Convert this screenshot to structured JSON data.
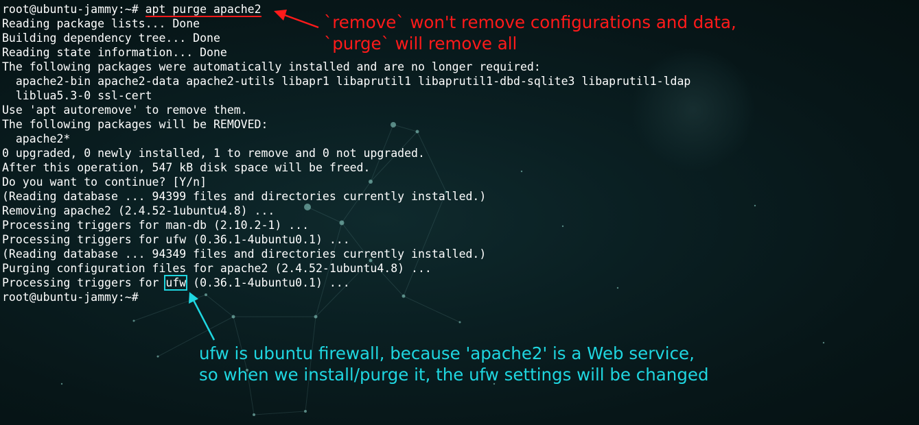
{
  "terminal": {
    "lines": [
      "root@ubuntu-jammy:~# apt purge apache2",
      "Reading package lists... Done",
      "Building dependency tree... Done",
      "Reading state information... Done",
      "The following packages were automatically installed and are no longer required:",
      "  apache2-bin apache2-data apache2-utils libapr1 libaprutil1 libaprutil1-dbd-sqlite3 libaprutil1-ldap",
      "  liblua5.3-0 ssl-cert",
      "Use 'apt autoremove' to remove them.",
      "The following packages will be REMOVED:",
      "  apache2*",
      "0 upgraded, 0 newly installed, 1 to remove and 0 not upgraded.",
      "After this operation, 547 kB disk space will be freed.",
      "Do you want to continue? [Y/n]",
      "(Reading database ... 94399 files and directories currently installed.)",
      "Removing apache2 (2.4.52-1ubuntu4.8) ...",
      "Processing triggers for man-db (2.10.2-1) ...",
      "Processing triggers for ufw (0.36.1-4ubuntu0.1) ...",
      "(Reading database ... 94349 files and directories currently installed.)",
      "Purging configuration files for apache2 (2.4.52-1ubuntu4.8) ...",
      "Processing triggers for ufw (0.36.1-4ubuntu0.1) ...",
      "root@ubuntu-jammy:~#"
    ],
    "first_prompt": "root@ubuntu-jammy:~# ",
    "first_command": "apt purge apache2",
    "highlight_prefix": "Processing triggers for ",
    "highlight_word": "ufw",
    "highlight_suffix": " (0.36.1-4ubuntu0.1) ..."
  },
  "annotations": {
    "red_note_line1": "`remove` won't remove configurations and data,",
    "red_note_line2": "`purge` will remove all",
    "cyan_note_line1": "ufw is ubuntu firewall, because 'apache2' is a Web service,",
    "cyan_note_line2": "so when we install/purge it, the ufw settings will be changed",
    "red_color": "#ff1a1a",
    "cyan_color": "#1fd6e0"
  },
  "colors": {
    "background": "#071618",
    "text": "#ffffff"
  }
}
